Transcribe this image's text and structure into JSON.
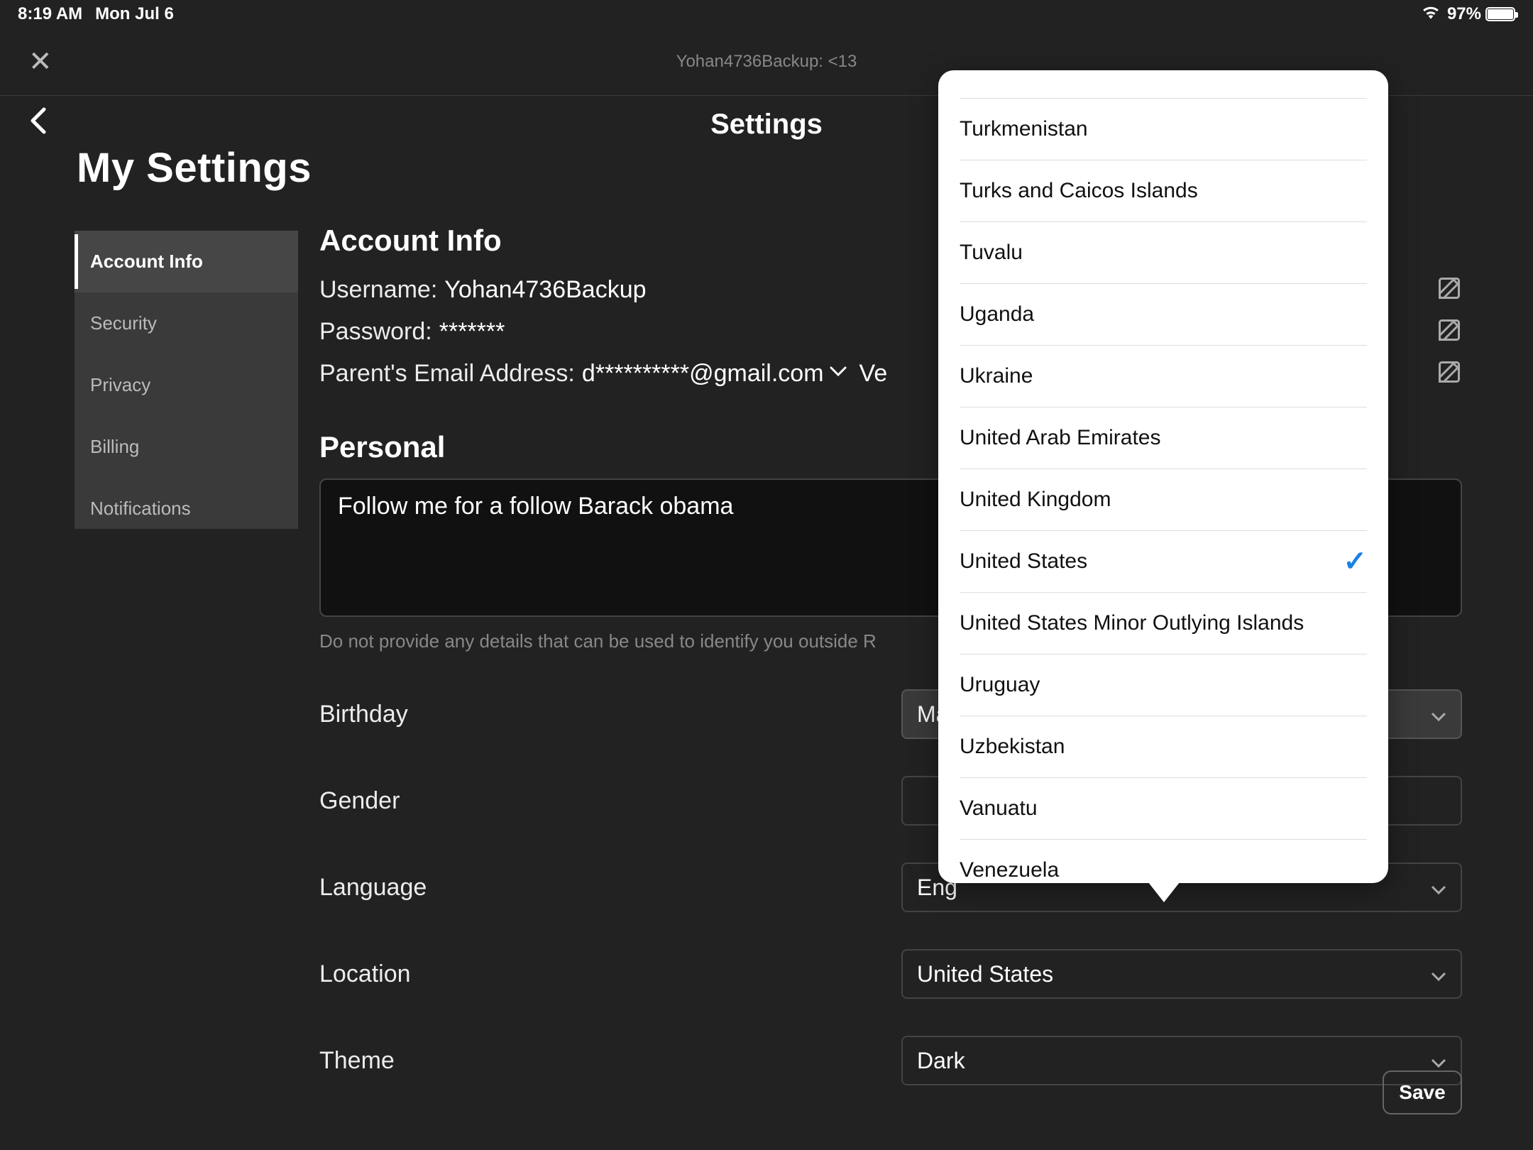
{
  "status": {
    "time": "8:19 AM",
    "date": "Mon Jul 6",
    "battery_pct": "97%"
  },
  "app_bar": {
    "title": "Yohan4736Backup: <13"
  },
  "header": {
    "settings_title": "Settings",
    "page_heading": "My Settings"
  },
  "sidebar": {
    "items": [
      {
        "label": "Account Info",
        "active": true
      },
      {
        "label": "Security",
        "active": false
      },
      {
        "label": "Privacy",
        "active": false
      },
      {
        "label": "Billing",
        "active": false
      },
      {
        "label": "Notifications",
        "active": false
      }
    ]
  },
  "account_info": {
    "section_title": "Account Info",
    "username_label": "Username:",
    "username_value": "Yohan4736Backup",
    "password_label": "Password:",
    "password_value": "*******",
    "parent_email_label": "Parent's Email Address:",
    "parent_email_value": "d**********@gmail.com",
    "verified_text": "Ve"
  },
  "personal": {
    "section_title": "Personal",
    "bio_value": "Follow me for a follow Barack obama",
    "hint": "Do not provide any details that can be used to identify you outside R",
    "birthday_label": "Birthday",
    "birthday_value": "Mar",
    "gender_label": "Gender",
    "gender_value": "",
    "language_label": "Language",
    "language_value": "Eng",
    "location_label": "Location",
    "location_value": "United States",
    "theme_label": "Theme",
    "theme_value": "Dark"
  },
  "save_label": "Save",
  "country_popover": {
    "partial_top": "",
    "selected": "United States",
    "items": [
      "Turkmenistan",
      "Turks and Caicos Islands",
      "Tuvalu",
      "Uganda",
      "Ukraine",
      "United Arab Emirates",
      "United Kingdom",
      "United States",
      "United States Minor Outlying Islands",
      "Uruguay",
      "Uzbekistan",
      "Vanuatu",
      "Venezuela"
    ]
  }
}
